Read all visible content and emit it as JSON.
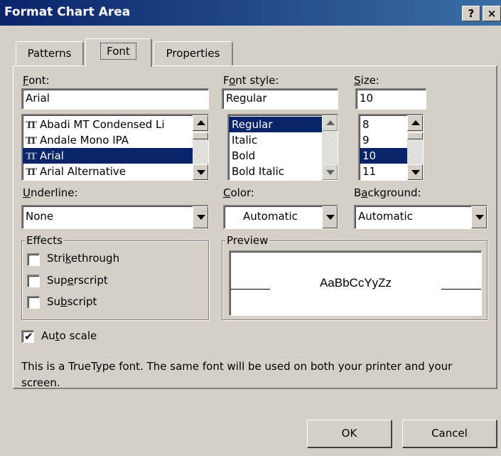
{
  "window": {
    "title": "Format Chart Area",
    "help_glyph": "?",
    "close_glyph": "×"
  },
  "tabs": [
    {
      "label": "Patterns",
      "active": false
    },
    {
      "label": "Font",
      "active": true
    },
    {
      "label": "Properties",
      "active": false
    }
  ],
  "font": {
    "label": "Font:",
    "value": "Arial",
    "items": [
      {
        "label": "Abadi MT Condensed Li",
        "icon": "truetype-icon",
        "selected": false
      },
      {
        "label": "Andale Mono IPA",
        "icon": "truetype-icon",
        "selected": false
      },
      {
        "label": "Arial",
        "icon": "truetype-icon",
        "selected": true
      },
      {
        "label": "Arial Alternative",
        "icon": "truetype-icon",
        "selected": false
      }
    ]
  },
  "font_style": {
    "label": "Font style:",
    "value": "Regular",
    "items": [
      {
        "label": "Regular",
        "selected": true
      },
      {
        "label": "Italic",
        "selected": false
      },
      {
        "label": "Bold",
        "selected": false
      },
      {
        "label": "Bold Italic",
        "selected": false
      }
    ]
  },
  "size": {
    "label": "Size:",
    "value": "10",
    "items": [
      {
        "label": "8",
        "selected": false
      },
      {
        "label": "9",
        "selected": false
      },
      {
        "label": "10",
        "selected": true
      },
      {
        "label": "11",
        "selected": false
      }
    ]
  },
  "underline": {
    "label": "Underline:",
    "value": "None"
  },
  "color": {
    "label": "Color:",
    "value": "Automatic"
  },
  "background": {
    "label": "Background:",
    "value": "Automatic"
  },
  "effects": {
    "title": "Effects",
    "strikethrough": {
      "label": "Strikethrough",
      "checked": false
    },
    "superscript": {
      "label": "Superscript",
      "checked": false
    },
    "subscript": {
      "label": "Subscript",
      "checked": false
    }
  },
  "preview": {
    "title": "Preview",
    "sample": "AaBbCcYyZz"
  },
  "auto_scale": {
    "label": "Auto scale",
    "checked": true,
    "check_glyph": "✔"
  },
  "info_text": "This is a TrueType font.  The same font will be used on both your printer and your screen.",
  "buttons": {
    "ok": "OK",
    "cancel": "Cancel"
  },
  "colors": {
    "titlebar_start": "#0a246a",
    "titlebar_end": "#3a6ea5",
    "selection": "#0a246a",
    "face": "#d4d0c8"
  }
}
